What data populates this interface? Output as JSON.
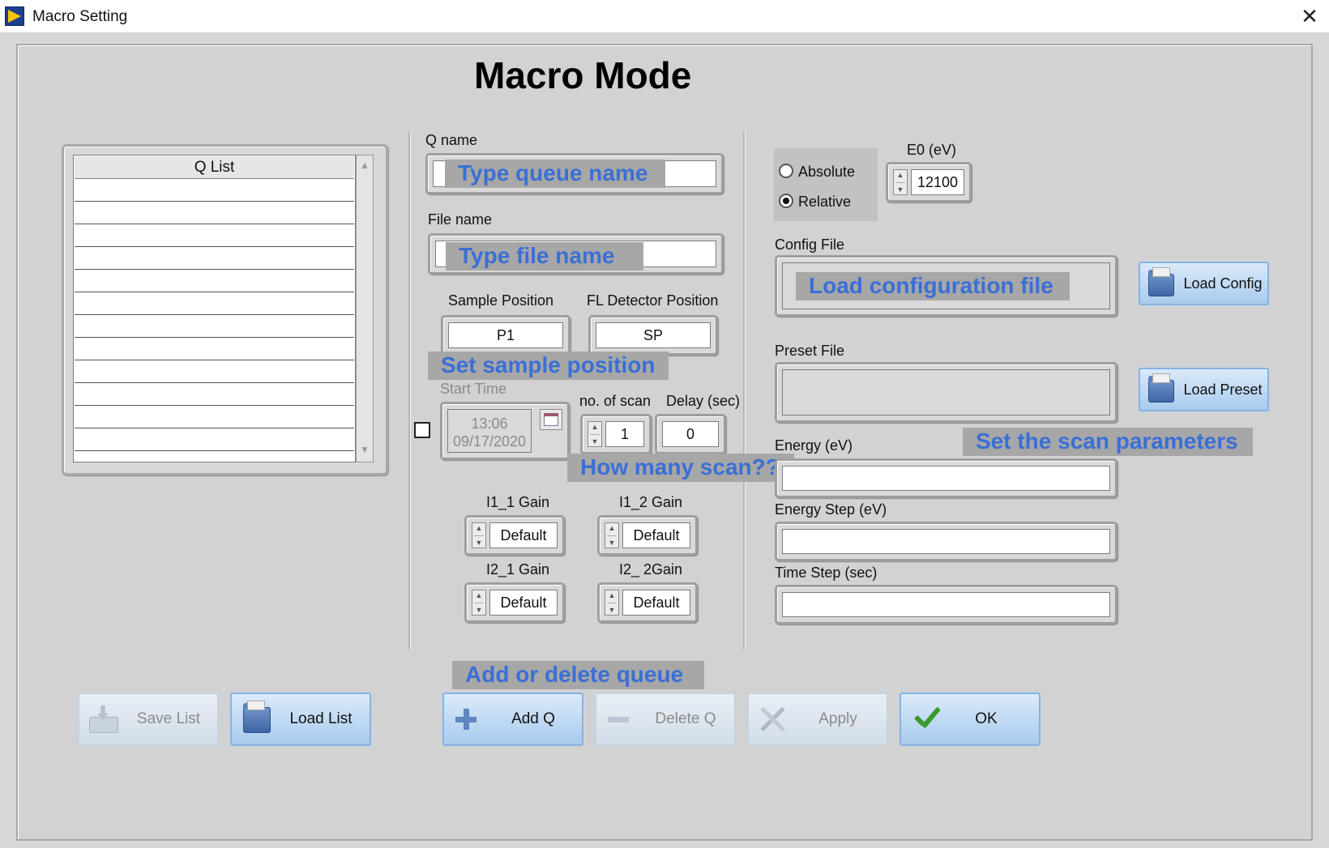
{
  "window": {
    "title": "Macro Setting",
    "close_glyph": "✕",
    "icon": "labview-vi-icon"
  },
  "heading": "Macro Mode",
  "qlist": {
    "header": "Q List",
    "rows": [
      "",
      "",
      "",
      "",
      "",
      "",
      "",
      "",
      "",
      "",
      "",
      ""
    ]
  },
  "q_name": {
    "label": "Q name",
    "value": ""
  },
  "file_name": {
    "label": "File name",
    "value": ""
  },
  "sample_position": {
    "label": "Sample Position",
    "value": "P1"
  },
  "fl_detector_position": {
    "label": "FL Detector Position",
    "value": "SP"
  },
  "start_time": {
    "label": "Start Time",
    "time": "13:06",
    "date": "09/17/2020",
    "enabled": false
  },
  "no_of_scan": {
    "label": "no. of scan",
    "value": "1"
  },
  "delay": {
    "label": "Delay (sec)",
    "value": "0"
  },
  "gains": {
    "i1_1": {
      "label": "I1_1 Gain",
      "value": "Default"
    },
    "i1_2": {
      "label": "I1_2 Gain",
      "value": "Default"
    },
    "i2_1": {
      "label": "I2_1 Gain",
      "value": "Default"
    },
    "i2_2": {
      "label": "I2_ 2Gain",
      "value": "Default"
    }
  },
  "energy_mode": {
    "options": [
      "Absolute",
      "Relative"
    ],
    "selected": "Relative"
  },
  "e0": {
    "label": "E0 (eV)",
    "value": "12100"
  },
  "config_file": {
    "label": "Config File",
    "value": ""
  },
  "preset_file": {
    "label": "Preset File",
    "value": ""
  },
  "energy": {
    "label": "Energy (eV)",
    "value": ""
  },
  "energy_step": {
    "label": "Energy Step (eV)",
    "value": ""
  },
  "time_step": {
    "label": "Time Step (sec)",
    "value": ""
  },
  "buttons": {
    "load_config": "Load Config",
    "load_preset": "Load Preset",
    "save_list": "Save List",
    "load_list": "Load List",
    "add_q": "Add Q",
    "delete_q": "Delete Q",
    "apply": "Apply",
    "ok": "OK"
  },
  "annotations": {
    "queue_name": "Type queue name",
    "file_name": "Type file name",
    "sample_position": "Set sample position",
    "scan_count": "How many scan??",
    "config": "Load configuration file",
    "scan_params": "Set the scan parameters",
    "add_delete": "Add or delete queue"
  },
  "colors": {
    "annotation_text": "#3a6fd6",
    "annotation_bg": "#a7a7a7",
    "button_blue": "#a8cbed"
  }
}
